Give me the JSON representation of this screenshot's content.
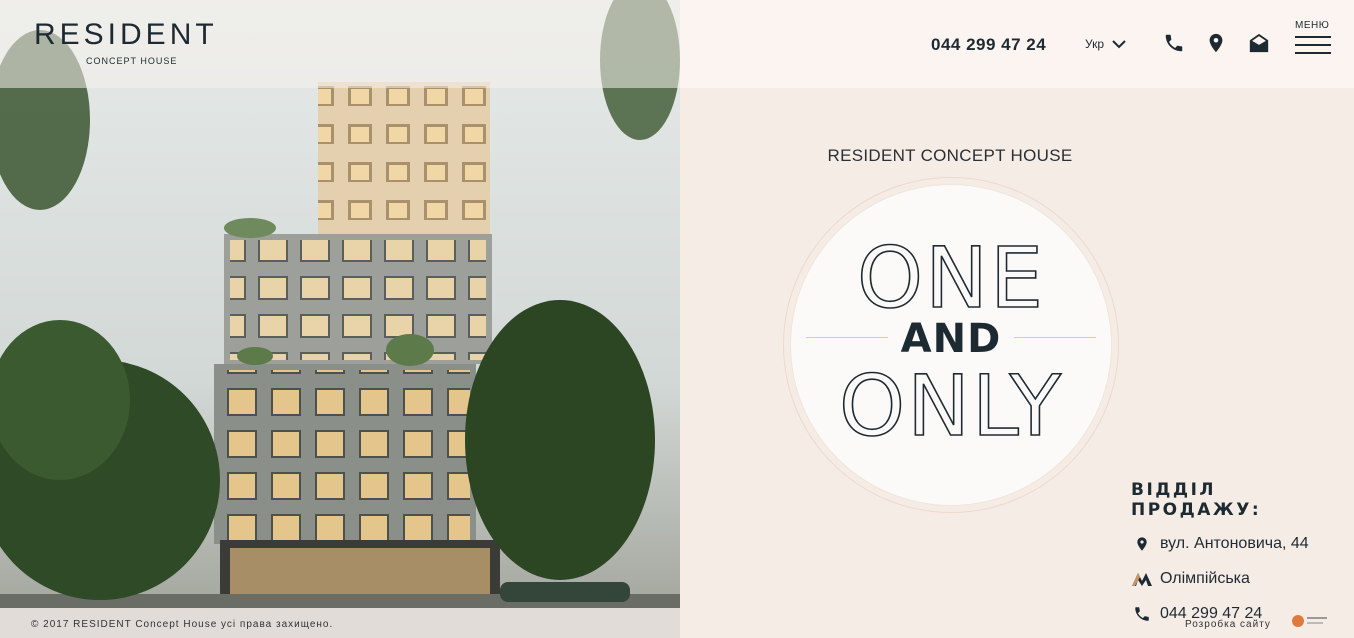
{
  "header": {
    "logo_text": "RESIDENT",
    "logo_subtitle": "CONCEPT HOUSE",
    "phone": "044 299 47 24",
    "language": "Укр",
    "menu_label": "МЕНЮ",
    "icons": [
      "phone-icon",
      "location-pin-icon",
      "mail-icon",
      "hamburger-icon"
    ]
  },
  "main": {
    "subtitle": "RESIDENT CONCEPT HOUSE",
    "word_top": "ONE",
    "word_middle": "AND",
    "word_bottom": "ONLY"
  },
  "sales": {
    "title": "ВІДДІЛ ПРОДАЖУ:",
    "address": "вул. Антоновича, 44",
    "metro": "Олімпійська",
    "phone": "044 299 47 24"
  },
  "footer": {
    "copyright": "© 2017 RESIDENT Concept House усі права захищено.",
    "developer_label": "Розробка сайту"
  },
  "colors": {
    "accent": "#c9936a",
    "dark": "#1e2a32",
    "background": "#f6ece6"
  }
}
